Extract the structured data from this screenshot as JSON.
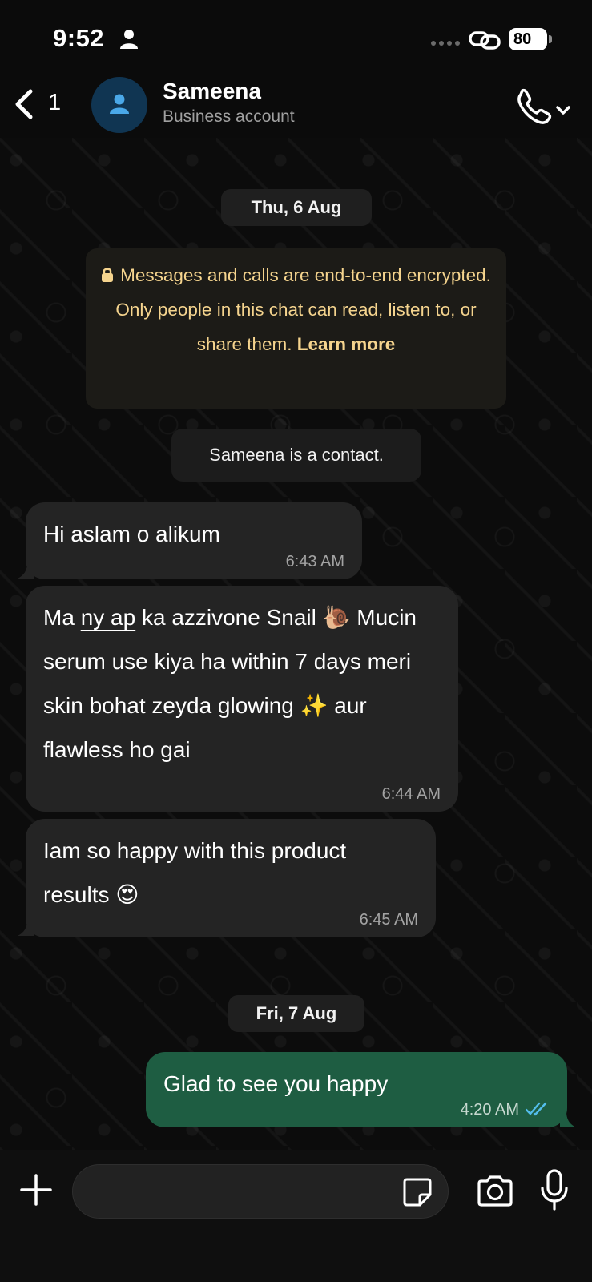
{
  "status_bar": {
    "time": "9:52",
    "battery": "80"
  },
  "header": {
    "back_count": "1",
    "contact_name": "Sameena",
    "contact_subtitle": "Business account"
  },
  "chat": {
    "date_1": "Thu, 6 Aug",
    "encryption_text": "Messages and calls are end-to-end encrypted. Only people in this chat can read, listen to, or share them.",
    "encryption_link": "Learn more",
    "contact_note": "Sameena is a contact.",
    "messages": [
      {
        "direction": "incoming",
        "text": "Hi aslam o alikum",
        "time": "6:43 AM"
      },
      {
        "direction": "incoming",
        "text_part1": "Ma ",
        "text_underlined": "ny ap",
        "text_part2": " ka azzivone Snail 🐌 Mucin serum use kiya ha within 7 days meri skin bohat zeyda glowing ✨ aur flawless ho gai",
        "time": "6:44 AM"
      },
      {
        "direction": "incoming",
        "text": "Iam so happy with this product results 😍",
        "time": "6:45 AM"
      },
      {
        "direction": "outgoing",
        "text": "Glad to see you happy",
        "time": "4:20 AM",
        "status": "read"
      }
    ],
    "date_2": "Fri, 7 Aug"
  },
  "composer": {
    "input_value": "",
    "input_placeholder": ""
  },
  "colors": {
    "incoming_bubble": "#242424",
    "outgoing_bubble": "#1e5d42",
    "encryption_text": "#f5d48e",
    "read_ticks": "#53bdeb",
    "avatar_bg": "#103552"
  }
}
